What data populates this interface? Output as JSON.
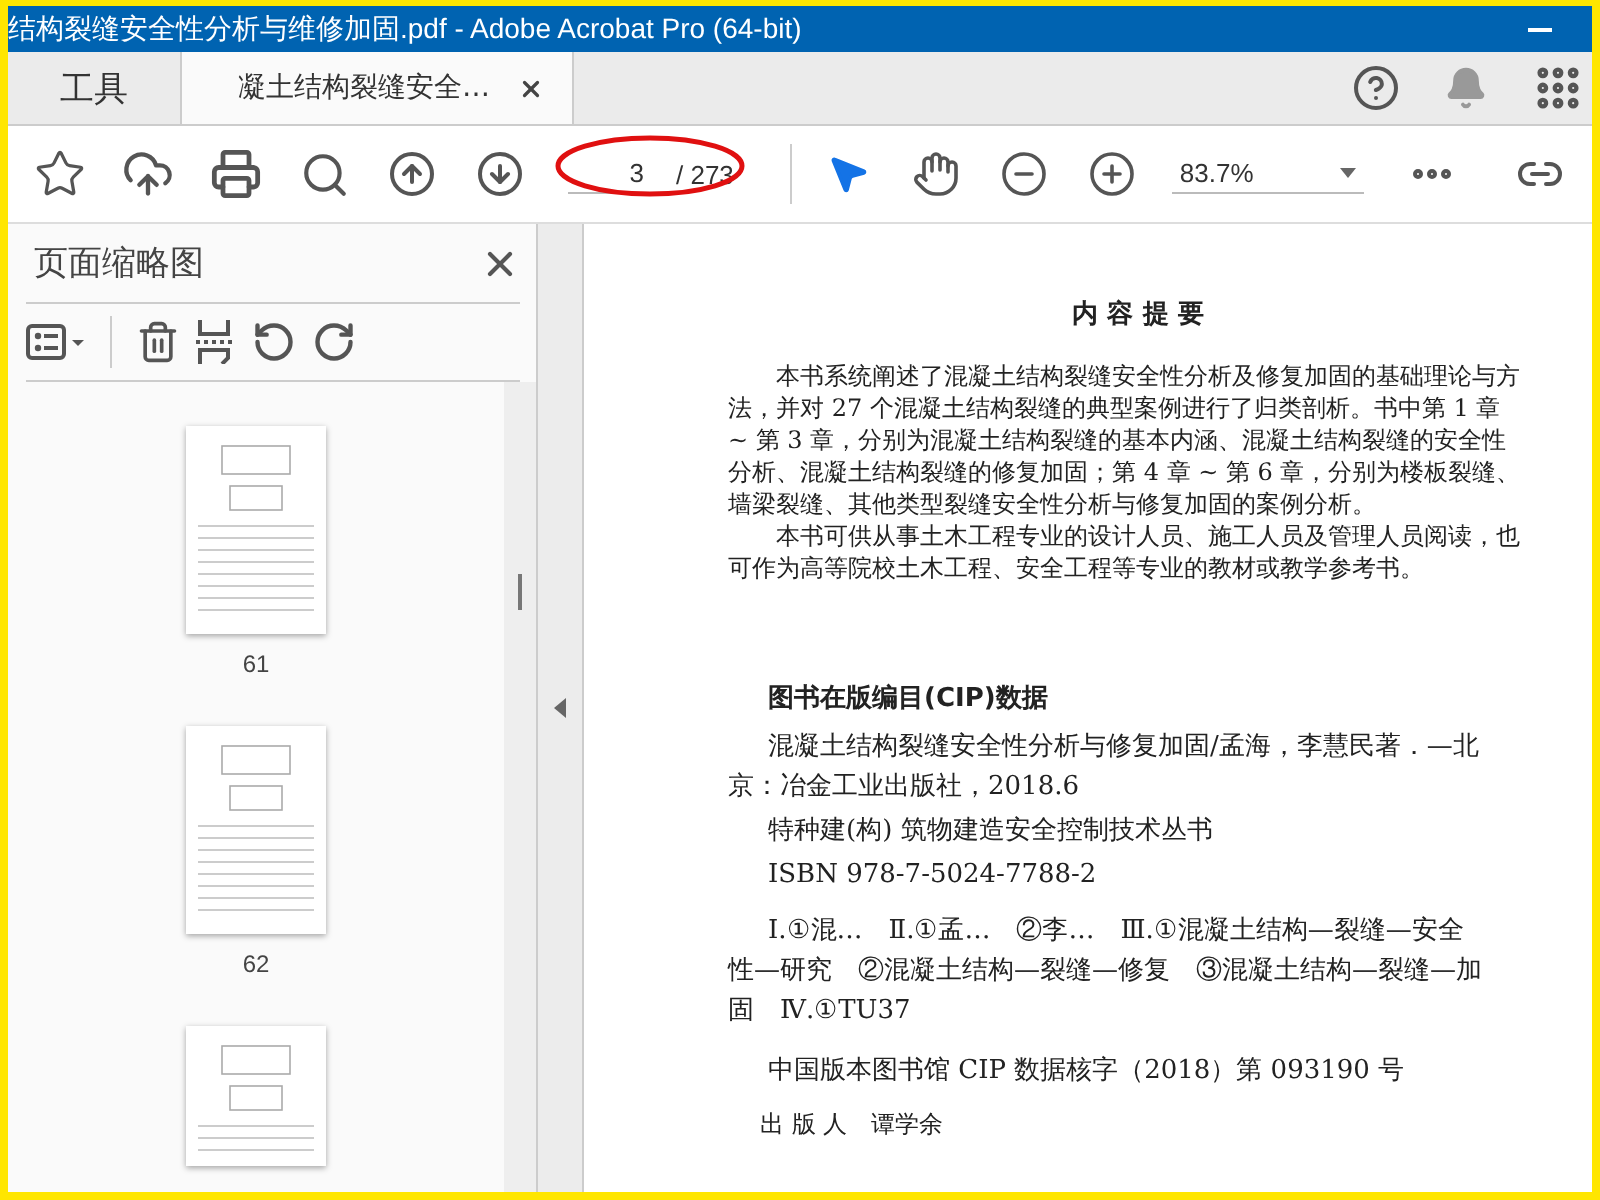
{
  "window": {
    "title": "结构裂缝安全性分析与维修加固.pdf - Adobe Acrobat Pro (64-bit)"
  },
  "tabs": [
    {
      "label": "工具",
      "selected": false,
      "closable": false
    },
    {
      "label": "凝土结构裂缝安全…",
      "selected": true,
      "closable": true
    }
  ],
  "toolbar": {
    "page_current": "3",
    "page_total": "/ 273",
    "zoom": "83.7%"
  },
  "sidebar": {
    "title": "页面缩略图",
    "thumbnails": [
      {
        "kind": "full",
        "label": "61"
      },
      {
        "kind": "full",
        "label": "62"
      },
      {
        "kind": "cut"
      }
    ]
  },
  "document": {
    "heading": "内 容 提 要",
    "paragraphs": [
      "本书系统阐述了混凝土结构裂缝安全性分析及修复加固的基础理论与方法，并对 27 个混凝土结构裂缝的典型案例进行了归类剖析。书中第 1 章 ~ 第 3 章，分别为混凝土结构裂缝的基本内涵、混凝土结构裂缝的安全性分析、混凝土结构裂缝的修复加固；第 4 章 ~ 第 6 章，分别为楼板裂缝、墙梁裂缝、其他类型裂缝安全性分析与修复加固的案例分析。",
      "本书可供从事土木工程专业的设计人员、施工人员及管理人员阅读，也可作为高等院校土木工程、安全工程等专业的教材或教学参考书。"
    ],
    "cip_heading": "图书在版编目(CIP)数据",
    "cip_entries": [
      "混凝土结构裂缝安全性分析与修复加固/孟海，李慧民著．—北京：冶金工业出版社，2018.6",
      "特种建(构) 筑物建造安全控制技术丛书",
      "ISBN 978-7-5024-7788-2"
    ],
    "cip_classification": "Ⅰ.①混…　Ⅱ.①孟…　②李…　Ⅲ.①混凝土结构—裂缝—安全性—研究　②混凝土结构—裂缝—修复　③混凝土结构—裂缝—加固　Ⅳ.①TU37",
    "cip_number": "中国版本图书馆 CIP 数据核字（2018）第 093190 号",
    "publisher_line": "出 版 人　谭学余"
  }
}
